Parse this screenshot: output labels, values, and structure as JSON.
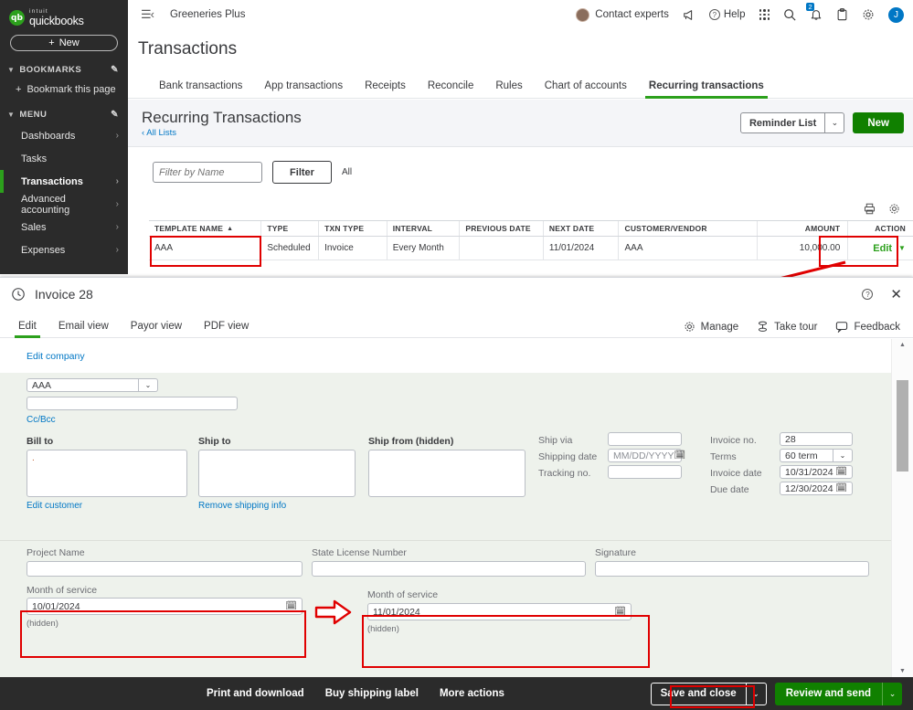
{
  "sidebar": {
    "brand_intuit": "intuit",
    "brand_name": "quickbooks",
    "new_button": "New",
    "bookmarks_label": "BOOKMARKS",
    "bookmark_this_page": "Bookmark this page",
    "menu_label": "MENU",
    "items": [
      {
        "label": "Dashboards",
        "chevron": true
      },
      {
        "label": "Tasks",
        "chevron": false
      },
      {
        "label": "Transactions",
        "chevron": true
      },
      {
        "label": "Advanced accounting",
        "chevron": true
      },
      {
        "label": "Sales",
        "chevron": true
      },
      {
        "label": "Expenses",
        "chevron": true
      }
    ],
    "active_item": "Transactions"
  },
  "topbar": {
    "company": "Greeneries Plus",
    "contact_experts": "Contact experts",
    "help": "Help",
    "notification_count": "2",
    "avatar_initial": "J"
  },
  "page": {
    "title": "Transactions",
    "tabs": [
      {
        "label": "Bank transactions",
        "active": false
      },
      {
        "label": "App transactions",
        "active": false
      },
      {
        "label": "Receipts",
        "active": false
      },
      {
        "label": "Reconcile",
        "active": false
      },
      {
        "label": "Rules",
        "active": false
      },
      {
        "label": "Chart of accounts",
        "active": false
      },
      {
        "label": "Recurring transactions",
        "active": true
      }
    ]
  },
  "subheader": {
    "heading": "Recurring Transactions",
    "back_link": "All Lists",
    "reminder_list": "Reminder List",
    "new_button": "New"
  },
  "filters": {
    "name_placeholder": "Filter by Name",
    "filter_button": "Filter",
    "all_label": "All"
  },
  "table": {
    "columns": [
      "TEMPLATE NAME",
      "TYPE",
      "TXN TYPE",
      "INTERVAL",
      "PREVIOUS DATE",
      "NEXT DATE",
      "CUSTOMER/VENDOR",
      "AMOUNT",
      "ACTION"
    ],
    "sort_indicator": "▲",
    "rows": [
      {
        "template_name": "AAA",
        "type": "Scheduled",
        "txn_type": "Invoice",
        "interval": "Every Month",
        "previous_date": "",
        "next_date": "11/01/2024",
        "customer_vendor": "AAA",
        "amount": "10,000.00",
        "action": "Edit"
      }
    ]
  },
  "invoice": {
    "title": "Invoice 28",
    "tabs": [
      {
        "label": "Edit",
        "active": true
      },
      {
        "label": "Email view",
        "active": false
      },
      {
        "label": "Payor view",
        "active": false
      },
      {
        "label": "PDF view",
        "active": false
      }
    ],
    "manage": "Manage",
    "take_tour": "Take tour",
    "feedback": "Feedback",
    "edit_company": "Edit company",
    "customer_value": "AAA",
    "email_value": "",
    "cc_bcc": "Cc/Bcc",
    "bill_to_label": "Bill to",
    "bill_to_value": ".",
    "ship_to_label": "Ship to",
    "ship_from_label": "Ship from (hidden)",
    "edit_customer": "Edit customer",
    "remove_shipping": "Remove shipping info",
    "ship_via_label": "Ship via",
    "ship_via_value": "",
    "shipping_date_label": "Shipping date",
    "shipping_date_placeholder": "MM/DD/YYYY",
    "tracking_no_label": "Tracking no.",
    "tracking_no_value": "",
    "invoice_no_label": "Invoice no.",
    "invoice_no_value": "28",
    "terms_label": "Terms",
    "terms_value": "60 term",
    "invoice_date_label": "Invoice date",
    "invoice_date_value": "10/31/2024",
    "due_date_label": "Due date",
    "due_date_value": "12/30/2024",
    "project_name_label": "Project Name",
    "project_name_value": "",
    "state_license_label": "State License Number",
    "state_license_value": "",
    "signature_label": "Signature",
    "signature_value": "",
    "month_of_service_label": "Month of service",
    "month_of_service_before": "10/01/2024",
    "month_of_service_after": "11/01/2024",
    "hidden_note": "(hidden)",
    "footer": {
      "print_and_download": "Print and download",
      "buy_shipping_label": "Buy shipping label",
      "more_actions": "More actions",
      "save_and_close": "Save and close",
      "review_and_send": "Review and send"
    }
  },
  "colors": {
    "brand_green": "#2ca01c",
    "button_green": "#108000",
    "link_blue": "#0077c5",
    "annotation_red": "#e00000",
    "sidebar_dark": "#2b2b2b",
    "form_bg": "#eef2ec"
  }
}
